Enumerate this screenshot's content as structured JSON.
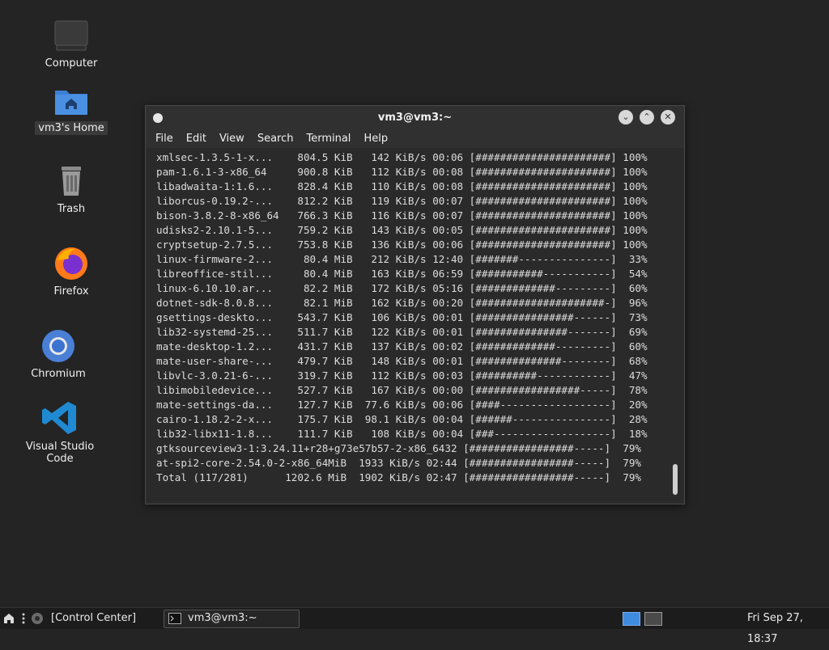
{
  "desktop": {
    "icons": [
      {
        "label": "Computer"
      },
      {
        "label": "vm3's Home"
      },
      {
        "label": "Trash"
      },
      {
        "label": "Firefox"
      },
      {
        "label": "Chromium"
      },
      {
        "label": "Visual Studio Code"
      }
    ]
  },
  "window": {
    "title": "vm3@vm3:~",
    "menu": [
      "File",
      "Edit",
      "View",
      "Search",
      "Terminal",
      "Help"
    ],
    "lines": [
      "xmlsec-1.3.5-1-x...    804.5 KiB   142 KiB/s 00:06 [######################] 100%",
      "pam-1.6.1-3-x86_64     900.8 KiB   112 KiB/s 00:08 [######################] 100%",
      "libadwaita-1:1.6...    828.4 KiB   110 KiB/s 00:08 [######################] 100%",
      "liborcus-0.19.2-...    812.2 KiB   119 KiB/s 00:07 [######################] 100%",
      "bison-3.8.2-8-x86_64   766.3 KiB   116 KiB/s 00:07 [######################] 100%",
      "udisks2-2.10.1-5...    759.2 KiB   143 KiB/s 00:05 [######################] 100%",
      "cryptsetup-2.7.5...    753.8 KiB   136 KiB/s 00:06 [######################] 100%",
      "linux-firmware-2...     80.4 MiB   212 KiB/s 12:40 [#######---------------]  33%",
      "libreoffice-stil...     80.4 MiB   163 KiB/s 06:59 [###########-----------]  54%",
      "linux-6.10.10.ar...     82.2 MiB   172 KiB/s 05:16 [#############---------]  60%",
      "dotnet-sdk-8.0.8...     82.1 MiB   162 KiB/s 00:20 [#####################-]  96%",
      "gsettings-deskto...    543.7 KiB   106 KiB/s 00:01 [################------]  73%",
      "lib32-systemd-25...    511.7 KiB   122 KiB/s 00:01 [###############-------]  69%",
      "mate-desktop-1.2...    431.7 KiB   137 KiB/s 00:02 [#############---------]  60%",
      "mate-user-share-...    479.7 KiB   148 KiB/s 00:01 [##############--------]  68%",
      "libvlc-3.0.21-6-...    319.7 KiB   112 KiB/s 00:03 [##########------------]  47%",
      "libimobiledevice...    527.7 KiB   167 KiB/s 00:00 [#################-----]  78%",
      "mate-settings-da...    127.7 KiB  77.6 KiB/s 00:06 [####------------------]  20%",
      "cairo-1.18.2-2-x...    175.7 KiB  98.1 KiB/s 00:04 [######----------------]  28%",
      "lib32-libx11-1.8...    111.7 KiB   108 KiB/s 00:04 [###-------------------]  18%",
      "gtksourceview3-1:3.24.11+r28+g73e57b57-2-x86_6432 [#################-----]  79%",
      "at-spi2-core-2.54.0-2-x86_64MiB  1933 KiB/s 02:44 [#################-----]  79%",
      "Total (117/281)      1202.6 MiB  1902 KiB/s 02:47 [#################-----]  79%"
    ]
  },
  "panel": {
    "control_center": "[Control Center]",
    "task": "vm3@vm3:~",
    "clock": "Fri Sep 27, 18:37"
  }
}
